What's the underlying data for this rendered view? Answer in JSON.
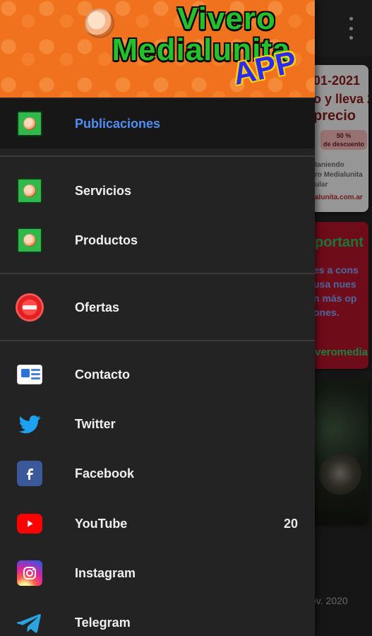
{
  "background": {
    "card_1": {
      "line_1": "01-2021",
      "line_2": "o y lleva 2",
      "line_3": "precio",
      "discount_1": "50 %",
      "discount_2": "de descuento",
      "small_1": "taniendo",
      "small_2": "ro Medialunita",
      "small_3": "ular",
      "web": "alunita.com.ar"
    },
    "card_2": {
      "title": "portant",
      "body_1": "es a cons",
      "body_2": "usa nues",
      "body_3": "n más op",
      "body_4": "ones.",
      "footer": "veromedial"
    },
    "date_text": "ov. 2020"
  },
  "drawer": {
    "header": {
      "title_line_1": "Vivero",
      "title_line_2": "Medialunita",
      "badge": "APP"
    },
    "items": [
      {
        "label": "Publicaciones",
        "icon": "publicaciones-icon",
        "active": true
      },
      {
        "label": "Servicios",
        "icon": "servicios-icon",
        "active": false
      },
      {
        "label": "Productos",
        "icon": "productos-icon",
        "active": false
      },
      {
        "label": "Ofertas",
        "icon": "ofertas-icon",
        "active": false
      },
      {
        "label": "Contacto",
        "icon": "contacto-icon",
        "active": false
      },
      {
        "label": "Twitter",
        "icon": "twitter-icon",
        "active": false
      },
      {
        "label": "Facebook",
        "icon": "facebook-icon",
        "active": false
      },
      {
        "label": "YouTube",
        "icon": "youtube-icon",
        "active": false,
        "count": "20"
      },
      {
        "label": "Instagram",
        "icon": "instagram-icon",
        "active": false
      },
      {
        "label": "Telegram",
        "icon": "telegram-icon",
        "active": false
      }
    ]
  },
  "colors": {
    "drawer_bg": "#232323",
    "active_text": "#4f8ff7",
    "header_orange": "#f0721e",
    "title_green": "#24c12f",
    "app_blue": "#2b2bf0",
    "twitter_blue": "#1da1f2",
    "telegram_blue": "#2aa3df"
  }
}
